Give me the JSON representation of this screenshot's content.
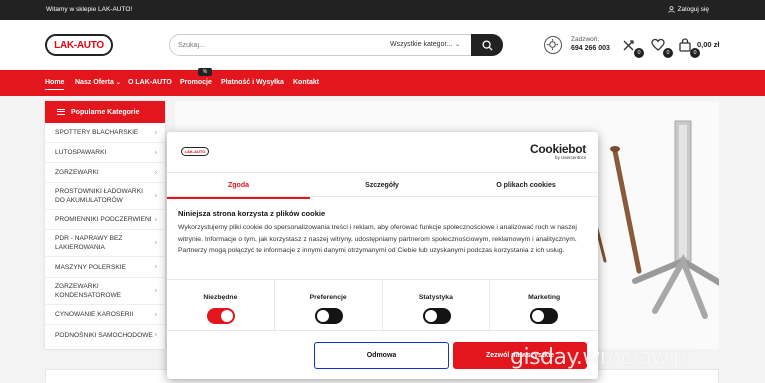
{
  "topbar": {
    "welcome": "Witamy w sklepie LAK-AUTO!",
    "login": "Zaloguj się"
  },
  "header": {
    "logo_text": "LAK-AUTO",
    "search_placeholder": "Szukaj...",
    "search_category": "Wszystkie kategor...",
    "phone_label": "Zadzwoń:",
    "phone_number": "694 266 003",
    "compare_count": "0",
    "wishlist_count": "0",
    "cart_count": "0",
    "cart_total": "0,00 zł"
  },
  "nav": {
    "items": [
      "Home",
      "Nasz Oferta",
      "O LAK-AUTO",
      "Promocje",
      "Płatność i Wysyłka",
      "Kontakt"
    ],
    "promo_badge": "%"
  },
  "sidebar": {
    "title": "Popularne Kategorie",
    "items": [
      "SPOTTERY BLACHARSKIE",
      "LUTOSPAWARKI",
      "ZGRZEWARKI",
      "PROSTOWNIKI ŁADOWARKI DO AKUMULATORÓW",
      "PROMIENNIKI PODCZERWIENI",
      "PDR - NAPRAWY BEZ LAKIEROWANIA",
      "MASZYNY POLERSKIE",
      "ZGRZEWARKI KONDENSATOROWE",
      "CYNOWANIE KAROSERII",
      "PODNOŚNIKI SAMOCHODOWE"
    ]
  },
  "cookie": {
    "brand": "Cookiebot",
    "brand_sub": "by Usercentrics",
    "logo_text": "LAK-AUTO",
    "tabs": [
      "Zgoda",
      "Szczegóły",
      "O plikach cookies"
    ],
    "title": "Niniejsza strona korzysta z plików cookie",
    "body": "Wykorzystujemy pliki cookie do spersonalizowania treści i reklam, aby oferować funkcje społecznościowe i analizować ruch w naszej witrynie. Informacje o tym, jak korzystasz z naszej witryny, udostępniamy partnerom społecznościowym, reklamowym i analitycznym. Partnerzy mogą połączyć te informacje z innymi danymi otrzymanymi od Ciebie lub uzyskanymi podczas korzystania z ich usług.",
    "toggles": [
      {
        "label": "Niezbędne",
        "on": true
      },
      {
        "label": "Preferencje",
        "on": false
      },
      {
        "label": "Statystyka",
        "on": false
      },
      {
        "label": "Marketing",
        "on": false
      }
    ],
    "deny_label": "Odmowa",
    "allow_label": "Zezwól na wszystkie"
  },
  "watermark": "gisday.wroclaw.pl",
  "colors": {
    "brand_red": "#e2161c",
    "dark": "#222222",
    "deny_border": "#1032cf"
  }
}
